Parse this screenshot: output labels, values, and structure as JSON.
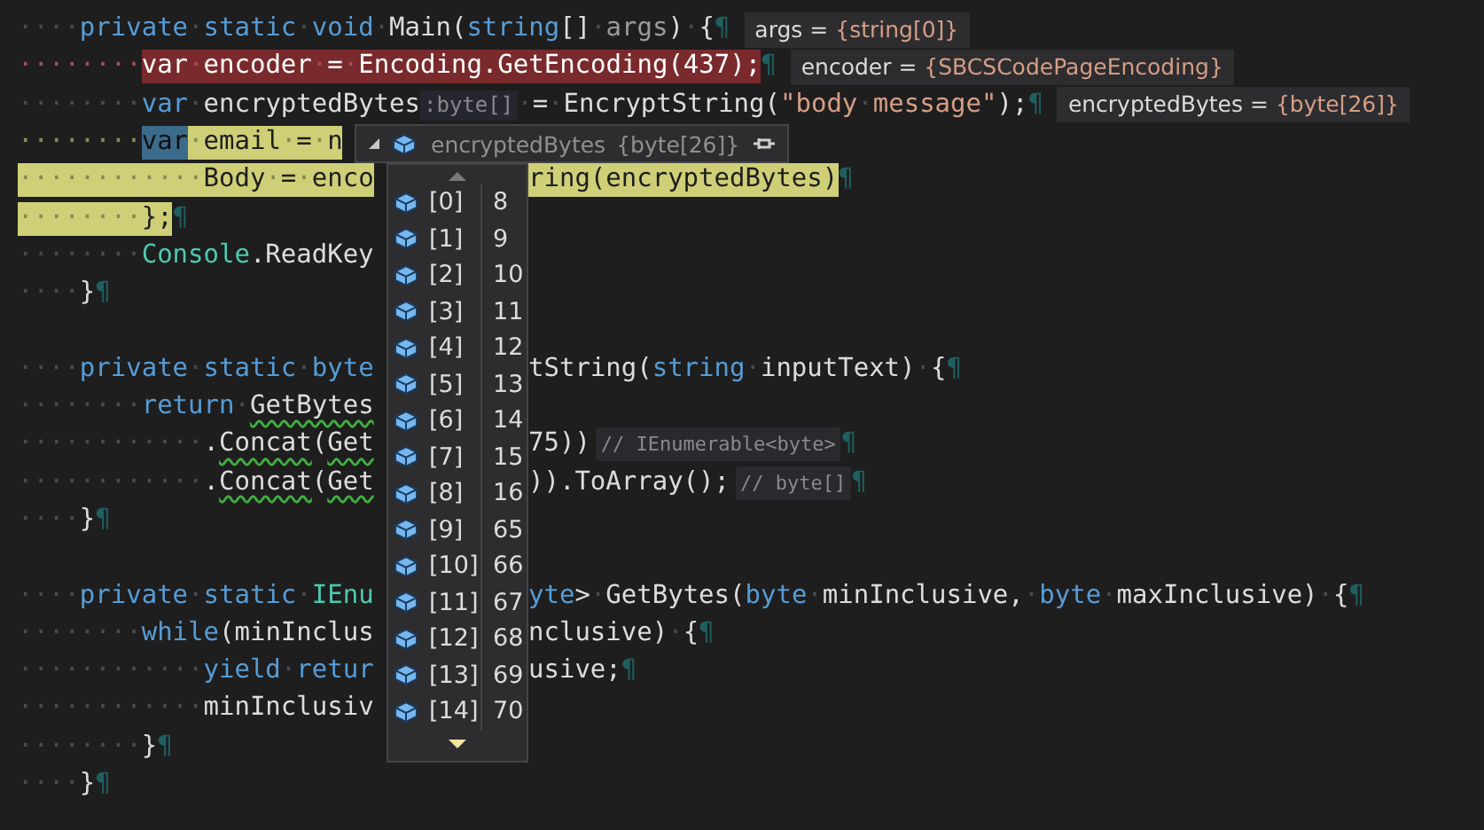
{
  "code_lines": [
    {
      "breakpoint": false,
      "current_statement": false,
      "left": [
        {
          "kind": "code",
          "segments": [
            {
              "text": "····",
              "kind": "indent"
            },
            {
              "text": "private·static·void",
              "kind": "kw"
            },
            {
              "text": "·Main(",
              "kind": "id"
            },
            {
              "text": "string",
              "kind": "kw"
            },
            {
              "text": "[]·",
              "kind": "id"
            },
            {
              "text": "args",
              "kind": "dim"
            },
            {
              "text": ")·{",
              "kind": "id"
            },
            {
              "text": "¶",
              "kind": "mark"
            }
          ]
        },
        {
          "kind": "value",
          "name": "args =",
          "value": "{string[0]}"
        }
      ]
    },
    {
      "breakpoint": true,
      "current_statement": false,
      "left": [
        {
          "kind": "code",
          "segments": [
            {
              "text": "········",
              "kind": "indent"
            },
            {
              "text": "var",
              "kind": "kw"
            },
            {
              "text": "·encoder·=·Encoding.GetEncoding(",
              "kind": "id"
            },
            {
              "text": "437",
              "kind": "num"
            },
            {
              "text": ");",
              "kind": "id"
            },
            {
              "text": "¶",
              "kind": "mark"
            }
          ]
        },
        {
          "kind": "value",
          "name": "encoder =",
          "value": "{SBCSCodePageEncoding}"
        }
      ]
    },
    {
      "breakpoint": false,
      "current_statement": false,
      "left": [
        {
          "kind": "code",
          "segments": [
            {
              "text": "········",
              "kind": "indent"
            },
            {
              "text": "var",
              "kind": "kw"
            },
            {
              "text": "·encryptedBytes",
              "kind": "id"
            }
          ]
        },
        {
          "kind": "inlay",
          "text": ":byte[]"
        },
        {
          "kind": "code",
          "segments": [
            {
              "text": "·=·EncryptString(",
              "kind": "id"
            },
            {
              "text": "\"body·message\"",
              "kind": "str"
            },
            {
              "text": ");",
              "kind": "id"
            },
            {
              "text": "¶",
              "kind": "mark"
            }
          ]
        },
        {
          "kind": "value",
          "name": "encryptedBytes =",
          "value": "{byte[26]}"
        }
      ]
    },
    {
      "breakpoint": false,
      "current_statement": true,
      "left": [
        {
          "kind": "code",
          "segments": [
            {
              "text": "········",
              "kind": "indent"
            },
            {
              "text": "var",
              "kind": "sel"
            },
            {
              "text": "·email·=·n",
              "kind": "id"
            }
          ]
        }
      ]
    },
    {
      "breakpoint": false,
      "current_statement": true,
      "left": [
        {
          "kind": "code",
          "segments": [
            {
              "text": "············Body·=·enco",
              "kind": "id"
            }
          ]
        }
      ],
      "right": [
        {
          "kind": "code",
          "segments": [
            {
              "text": "ring(encryptedBytes)",
              "kind": "id"
            },
            {
              "text": "¶",
              "kind": "mark"
            }
          ]
        }
      ]
    },
    {
      "breakpoint": false,
      "current_statement": true,
      "left": [
        {
          "kind": "code",
          "segments": [
            {
              "text": "········};",
              "kind": "id"
            },
            {
              "text": "¶",
              "kind": "mark"
            }
          ]
        }
      ]
    },
    {
      "breakpoint": false,
      "current_statement": false,
      "left": [
        {
          "kind": "code",
          "segments": [
            {
              "text": "········",
              "kind": "indent"
            },
            {
              "text": "Console",
              "kind": "type"
            },
            {
              "text": ".ReadKey",
              "kind": "id"
            }
          ]
        }
      ]
    },
    {
      "breakpoint": false,
      "current_statement": false,
      "left": [
        {
          "kind": "code",
          "segments": [
            {
              "text": "····}",
              "kind": "id"
            },
            {
              "text": "¶",
              "kind": "mark"
            }
          ]
        }
      ]
    },
    {
      "breakpoint": false,
      "current_statement": false
    },
    {
      "breakpoint": false,
      "current_statement": false,
      "left": [
        {
          "kind": "code",
          "segments": [
            {
              "text": "····",
              "kind": "indent"
            },
            {
              "text": "private·static·byte",
              "kind": "kw"
            }
          ]
        }
      ],
      "right": [
        {
          "kind": "code",
          "segments": [
            {
              "text": "tString(",
              "kind": "id"
            },
            {
              "text": "string",
              "kind": "kw"
            },
            {
              "text": "·inputText)·{",
              "kind": "id"
            },
            {
              "text": "¶",
              "kind": "mark"
            }
          ]
        }
      ]
    },
    {
      "breakpoint": false,
      "current_statement": false,
      "left": [
        {
          "kind": "code",
          "segments": [
            {
              "text": "········",
              "kind": "indent"
            },
            {
              "text": "return",
              "kind": "kw"
            },
            {
              "text": "·",
              "kind": "id"
            },
            {
              "text": "GetBytes",
              "kind": "warn"
            }
          ]
        }
      ]
    },
    {
      "breakpoint": false,
      "current_statement": false,
      "left": [
        {
          "kind": "code",
          "segments": [
            {
              "text": "············.",
              "kind": "id"
            },
            {
              "text": "Concat",
              "kind": "warn"
            },
            {
              "text": "(",
              "kind": "id"
            },
            {
              "text": "Get",
              "kind": "warn"
            }
          ]
        }
      ],
      "right": [
        {
          "kind": "code",
          "segments": [
            {
              "text": "75))",
              "kind": "id"
            }
          ]
        },
        {
          "kind": "comment",
          "text": "// IEnumerable<byte>"
        },
        {
          "kind": "code",
          "segments": [
            {
              "text": "¶",
              "kind": "mark"
            }
          ]
        }
      ]
    },
    {
      "breakpoint": false,
      "current_statement": false,
      "left": [
        {
          "kind": "code",
          "segments": [
            {
              "text": "············.",
              "kind": "id"
            },
            {
              "text": "Concat",
              "kind": "warn"
            },
            {
              "text": "(",
              "kind": "id"
            },
            {
              "text": "Get",
              "kind": "warn"
            }
          ]
        }
      ],
      "right": [
        {
          "kind": "code",
          "segments": [
            {
              "text": ")).ToArray();",
              "kind": "id"
            }
          ]
        },
        {
          "kind": "comment",
          "text": "// byte[]"
        },
        {
          "kind": "code",
          "segments": [
            {
              "text": "¶",
              "kind": "mark"
            }
          ]
        }
      ]
    },
    {
      "breakpoint": false,
      "current_statement": false,
      "left": [
        {
          "kind": "code",
          "segments": [
            {
              "text": "····}",
              "kind": "id"
            },
            {
              "text": "¶",
              "kind": "mark"
            }
          ]
        }
      ]
    },
    {
      "breakpoint": false,
      "current_statement": false
    },
    {
      "breakpoint": false,
      "current_statement": false,
      "left": [
        {
          "kind": "code",
          "segments": [
            {
              "text": "····",
              "kind": "indent"
            },
            {
              "text": "private·static",
              "kind": "kw"
            },
            {
              "text": "·",
              "kind": "id"
            },
            {
              "text": "IEnu",
              "kind": "type"
            }
          ]
        }
      ],
      "right": [
        {
          "kind": "code",
          "segments": [
            {
              "text": "yte",
              "kind": "kw"
            },
            {
              "text": ">·GetBytes(",
              "kind": "id"
            },
            {
              "text": "byte",
              "kind": "kw"
            },
            {
              "text": "·minInclusive,·",
              "kind": "id"
            },
            {
              "text": "byte",
              "kind": "kw"
            },
            {
              "text": "·maxInclusive)·{",
              "kind": "id"
            },
            {
              "text": "¶",
              "kind": "mark"
            }
          ]
        }
      ]
    },
    {
      "breakpoint": false,
      "current_statement": false,
      "left": [
        {
          "kind": "code",
          "segments": [
            {
              "text": "········",
              "kind": "indent"
            },
            {
              "text": "while",
              "kind": "kw"
            },
            {
              "text": "(minInclus",
              "kind": "id"
            }
          ]
        }
      ],
      "right": [
        {
          "kind": "code",
          "segments": [
            {
              "text": "nclusive)·{",
              "kind": "id"
            },
            {
              "text": "¶",
              "kind": "mark"
            }
          ]
        }
      ]
    },
    {
      "breakpoint": false,
      "current_statement": false,
      "left": [
        {
          "kind": "code",
          "segments": [
            {
              "text": "············",
              "kind": "indent"
            },
            {
              "text": "yield·retur",
              "kind": "kw"
            }
          ]
        }
      ],
      "right": [
        {
          "kind": "code",
          "segments": [
            {
              "text": "usive;",
              "kind": "id"
            },
            {
              "text": "¶",
              "kind": "mark"
            }
          ]
        }
      ]
    },
    {
      "breakpoint": false,
      "current_statement": false,
      "left": [
        {
          "kind": "code",
          "segments": [
            {
              "text": "············minInclusiv",
              "kind": "id"
            }
          ]
        }
      ]
    },
    {
      "breakpoint": false,
      "current_statement": false,
      "left": [
        {
          "kind": "code",
          "segments": [
            {
              "text": "········}",
              "kind": "id"
            },
            {
              "text": "¶",
              "kind": "mark"
            }
          ]
        }
      ]
    },
    {
      "breakpoint": false,
      "current_statement": false,
      "left": [
        {
          "kind": "code",
          "segments": [
            {
              "text": "····}",
              "kind": "id"
            },
            {
              "text": "¶",
              "kind": "mark"
            }
          ]
        }
      ]
    }
  ],
  "datatip": {
    "name": "encryptedBytes",
    "value": "{byte[26]}",
    "items": [
      {
        "index": "[0]",
        "value": "8"
      },
      {
        "index": "[1]",
        "value": "9"
      },
      {
        "index": "[2]",
        "value": "10"
      },
      {
        "index": "[3]",
        "value": "11"
      },
      {
        "index": "[4]",
        "value": "12"
      },
      {
        "index": "[5]",
        "value": "13"
      },
      {
        "index": "[6]",
        "value": "14"
      },
      {
        "index": "[7]",
        "value": "15"
      },
      {
        "index": "[8]",
        "value": "16"
      },
      {
        "index": "[9]",
        "value": "65"
      },
      {
        "index": "[10]",
        "value": "66"
      },
      {
        "index": "[11]",
        "value": "67"
      },
      {
        "index": "[12]",
        "value": "68"
      },
      {
        "index": "[13]",
        "value": "69"
      },
      {
        "index": "[14]",
        "value": "70"
      }
    ]
  }
}
